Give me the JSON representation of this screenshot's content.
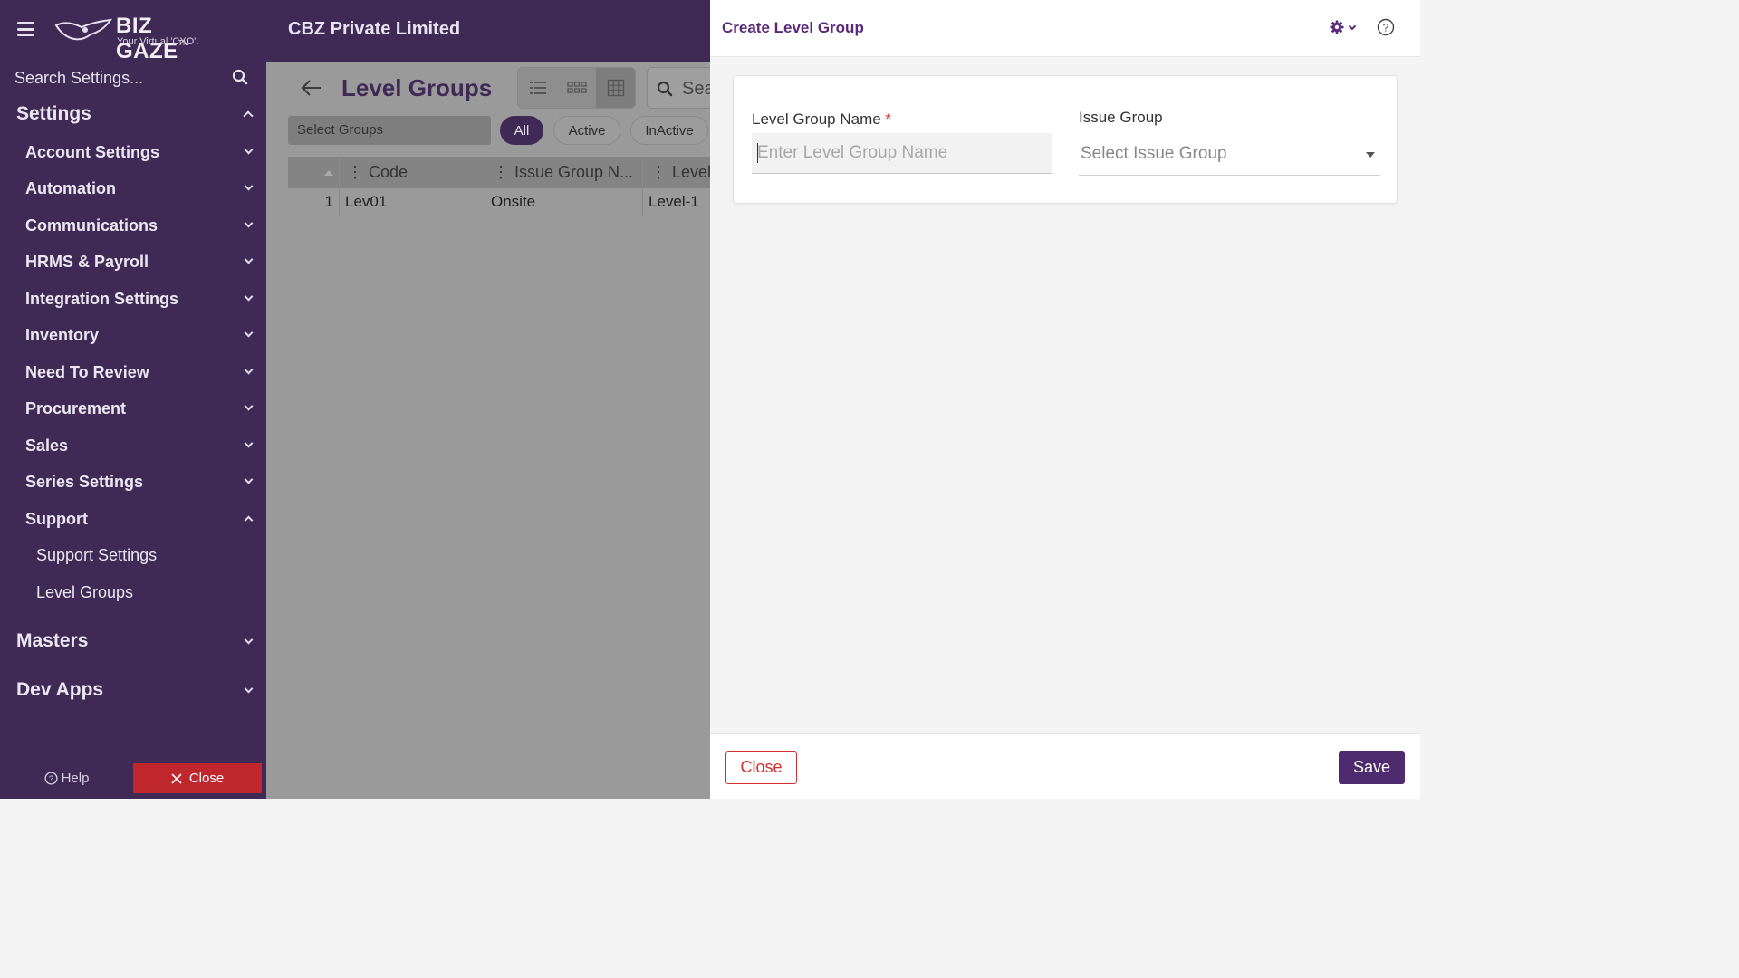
{
  "app": {
    "logo_text": "BIZ GAZE",
    "logo_trademark": "TM",
    "logo_tagline": "Your Virtual 'CXO'.",
    "company_name": "CBZ Private Limited"
  },
  "sidebar": {
    "search_placeholder": "Search Settings...",
    "settings_label": "Settings",
    "items": [
      {
        "label": "Account Settings"
      },
      {
        "label": "Automation"
      },
      {
        "label": "Communications"
      },
      {
        "label": "HRMS & Payroll"
      },
      {
        "label": "Integration Settings"
      },
      {
        "label": "Inventory"
      },
      {
        "label": "Need To Review"
      },
      {
        "label": "Procurement"
      },
      {
        "label": "Sales"
      },
      {
        "label": "Series Settings"
      },
      {
        "label": "Support"
      }
    ],
    "support_children": [
      {
        "label": "Support Settings"
      },
      {
        "label": "Level Groups"
      }
    ],
    "groups": [
      {
        "label": "Masters"
      },
      {
        "label": "Dev Apps"
      }
    ],
    "help_label": "Help",
    "close_label": "Close"
  },
  "main": {
    "title": "Level Groups",
    "search_placeholder": "Sea",
    "select_groups_placeholder": "Select Groups",
    "filters": {
      "all": "All",
      "active": "Active",
      "inactive": "InActive"
    },
    "columns": [
      "Code",
      "Issue Group N...",
      "Level"
    ],
    "rows": [
      {
        "index": "1",
        "code": "Lev01",
        "issue_group": "Onsite",
        "level": "Level-1"
      }
    ]
  },
  "panel": {
    "title": "Create Level Group",
    "fields": {
      "level_group_name": {
        "label": "Level Group Name",
        "required_mark": "*",
        "placeholder": "Enter Level Group Name",
        "value": ""
      },
      "issue_group": {
        "label": "Issue Group",
        "placeholder": "Select Issue Group"
      }
    },
    "close_label": "Close",
    "save_label": "Save"
  },
  "colors": {
    "brand_purple": "#3f2a55",
    "accent_purple": "#5a2a7a",
    "save_button": "#4e2a6e",
    "danger_red": "#c0272d"
  }
}
